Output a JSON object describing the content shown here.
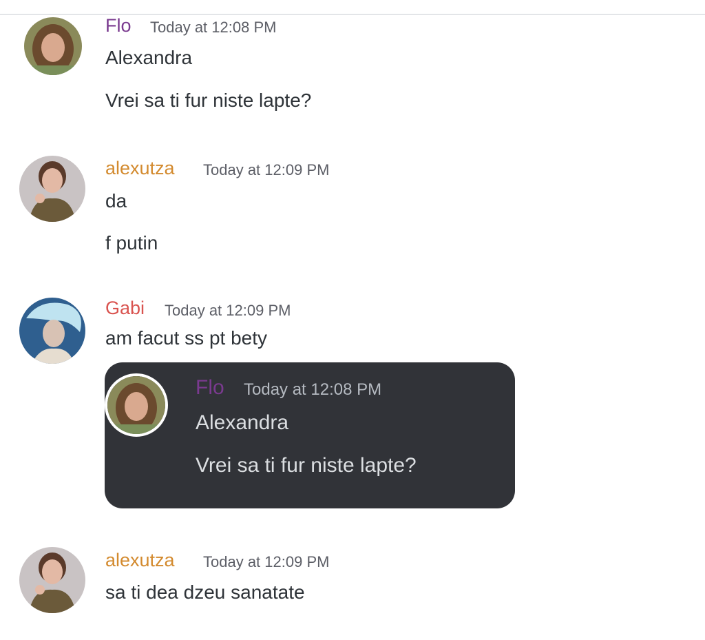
{
  "colors": {
    "flo": "#7a3a8f",
    "alexutza": "#d38a2e",
    "gabi": "#d9534f",
    "embed_background": "#313338"
  },
  "messages": [
    {
      "username": "Flo",
      "timestamp": "Today at 12:08 PM",
      "lines": [
        "Alexandra",
        "Vrei sa ti fur niste lapte?"
      ]
    },
    {
      "username": "alexutza",
      "timestamp": "Today at 12:09 PM",
      "lines": [
        "da",
        "f putin"
      ]
    },
    {
      "username": "Gabi",
      "timestamp": "Today at 12:09 PM",
      "lines": [
        "am facut ss pt bety"
      ],
      "embed": {
        "username": "Flo",
        "timestamp": "Today at 12:08 PM",
        "lines": [
          "Alexandra",
          "Vrei sa ti fur niste lapte?"
        ]
      }
    },
    {
      "username": "alexutza",
      "timestamp": "Today at 12:09 PM",
      "lines": [
        "sa ti dea dzeu sanatate"
      ]
    }
  ]
}
